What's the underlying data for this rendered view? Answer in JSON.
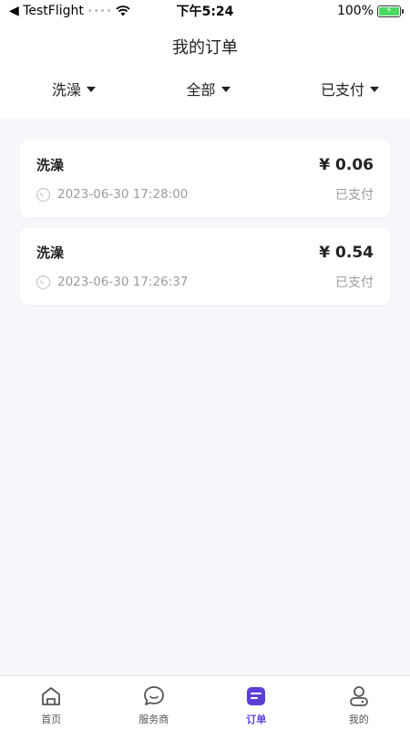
{
  "status_bar": {
    "back_label": "◀ TestFlight",
    "signal": "••••",
    "time": "下午5:24",
    "battery_percent": "100%",
    "battery_level": 1.0
  },
  "nav": {
    "title": "我的订单"
  },
  "filters": [
    {
      "label": "洗澡"
    },
    {
      "label": "全部"
    },
    {
      "label": "已支付"
    }
  ],
  "orders": [
    {
      "name": "洗澡",
      "price": "¥ 0.06",
      "time": "2023-06-30 17:28:00",
      "status": "已支付"
    },
    {
      "name": "洗澡",
      "price": "¥ 0.54",
      "time": "2023-06-30 17:26:37",
      "status": "已支付"
    }
  ],
  "tabs": [
    {
      "label": "首页",
      "icon": "home-icon"
    },
    {
      "label": "服务商",
      "icon": "chat-bubble-icon"
    },
    {
      "label": "订单",
      "icon": "order-icon"
    },
    {
      "label": "我的",
      "icon": "profile-icon"
    }
  ],
  "colors": {
    "accent": "#5b3fd8",
    "background": "#f7f7fb",
    "muted_text": "#9a9aa2",
    "battery": "#4cd964"
  }
}
